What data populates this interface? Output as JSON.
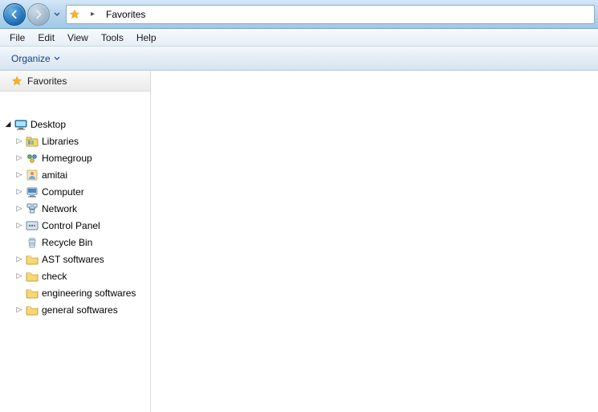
{
  "address": {
    "location": "Favorites"
  },
  "menu": {
    "file": "File",
    "edit": "Edit",
    "view": "View",
    "tools": "Tools",
    "help": "Help"
  },
  "toolbar": {
    "organize": "Organize"
  },
  "sidebar": {
    "favorites_header": "Favorites",
    "tree": [
      {
        "label": "Desktop",
        "icon": "desktop",
        "depth": 0,
        "expander": "open"
      },
      {
        "label": "Libraries",
        "icon": "libraries",
        "depth": 1,
        "expander": "closed"
      },
      {
        "label": "Homegroup",
        "icon": "homegroup",
        "depth": 1,
        "expander": "closed"
      },
      {
        "label": "amitai",
        "icon": "user",
        "depth": 1,
        "expander": "closed"
      },
      {
        "label": "Computer",
        "icon": "computer",
        "depth": 1,
        "expander": "closed"
      },
      {
        "label": "Network",
        "icon": "network",
        "depth": 1,
        "expander": "closed"
      },
      {
        "label": "Control Panel",
        "icon": "controlpanel",
        "depth": 1,
        "expander": "closed"
      },
      {
        "label": "Recycle Bin",
        "icon": "recycle",
        "depth": 1,
        "expander": "none"
      },
      {
        "label": "AST softwares",
        "icon": "folder",
        "depth": 1,
        "expander": "closed"
      },
      {
        "label": "check",
        "icon": "folder",
        "depth": 1,
        "expander": "closed"
      },
      {
        "label": "engineering softwares",
        "icon": "folder",
        "depth": 1,
        "expander": "none"
      },
      {
        "label": "general softwares",
        "icon": "folder",
        "depth": 1,
        "expander": "closed"
      }
    ]
  }
}
